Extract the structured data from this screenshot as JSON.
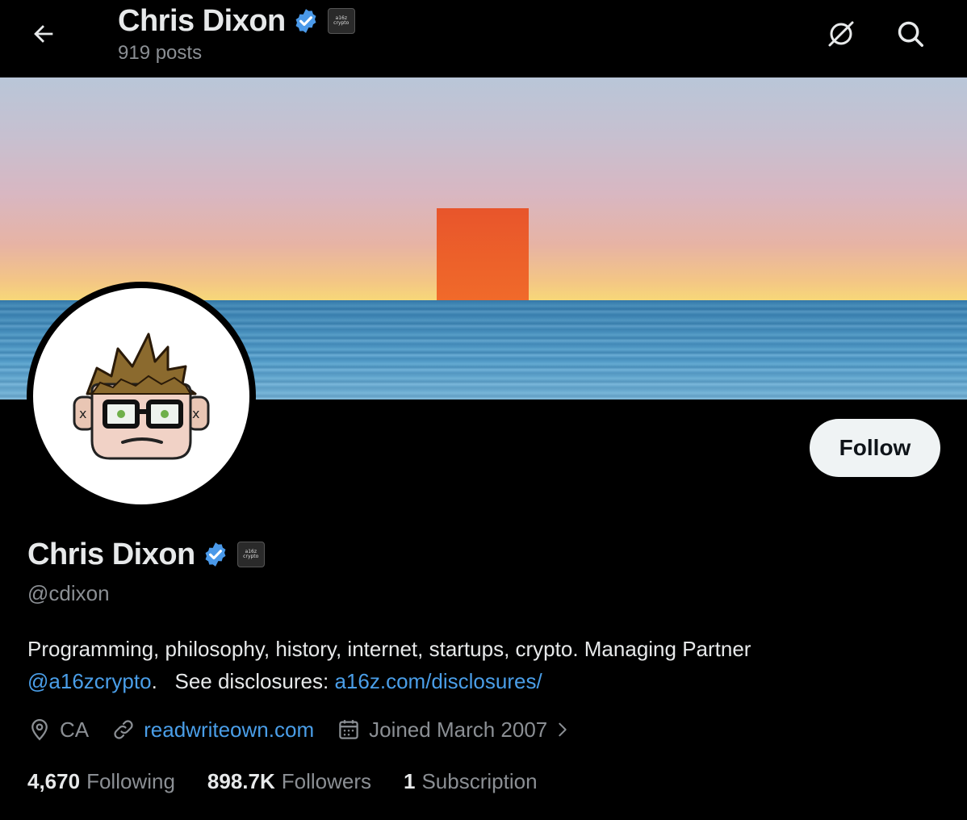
{
  "header": {
    "name": "Chris Dixon",
    "posts": "919 posts",
    "back_icon": "back-arrow-icon",
    "grok_icon": "grok-icon",
    "search_icon": "search-icon"
  },
  "profile": {
    "name": "Chris Dixon",
    "handle": "@cdixon",
    "affiliation_badge_text": "a16z crypto",
    "bio_text": "Programming, philosophy, history, internet, startups, crypto. Managing Partner",
    "bio_mention": "@a16zcrypto",
    "bio_sep": ".   See disclosures: ",
    "bio_link": "a16z.com/disclosures/",
    "follow_label": "Follow",
    "location": "CA",
    "website": "readwriteown.com",
    "joined": "Joined March 2007",
    "accent_color": "#4a9ee8",
    "verified_color": "#4a99e9"
  },
  "stats": [
    {
      "value": "4,670",
      "label": "Following"
    },
    {
      "value": "898.7K",
      "label": "Followers"
    },
    {
      "value": "1",
      "label": "Subscription"
    }
  ]
}
